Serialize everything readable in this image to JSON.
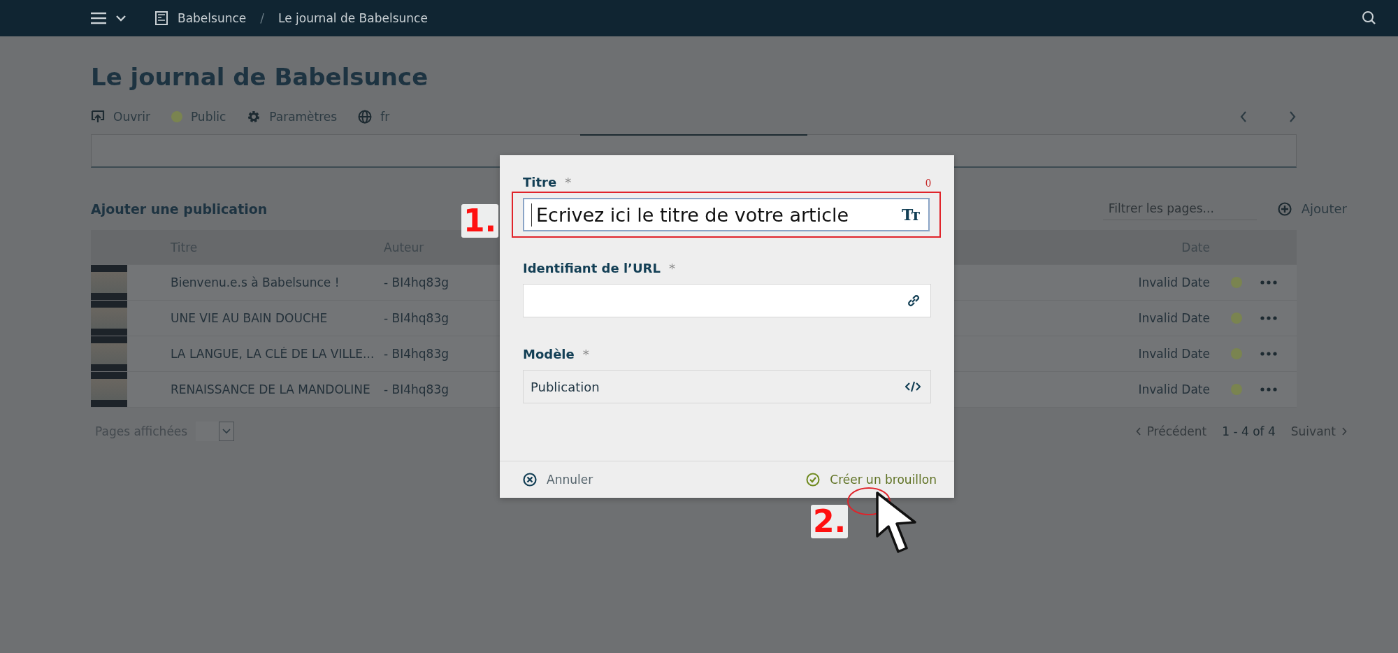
{
  "topbar": {
    "breadcrumb": [
      "Babelsunce",
      "Le journal de Babelsunce"
    ],
    "separator": "/"
  },
  "page": {
    "title": "Le journal de Babelsunce",
    "toolbar": [
      {
        "kind": "open",
        "label": "Ouvrir"
      },
      {
        "kind": "status",
        "label": "Public",
        "color": "#7a8450"
      },
      {
        "kind": "settings",
        "label": "Paramètres"
      },
      {
        "kind": "language",
        "label": "fr"
      }
    ]
  },
  "tabs": [
    {
      "selected": false
    },
    {
      "selected": true
    },
    {
      "selected": false
    }
  ],
  "section": {
    "title": "Ajouter une publication",
    "filter_placeholder": "Filtrer les pages...",
    "add_label": "Ajouter"
  },
  "table": {
    "columns": [
      "Titre",
      "Auteur",
      "Date"
    ],
    "rows": [
      {
        "title": "Bienvenu.e.s à Babelsunce !",
        "author": "- BI4hq83g",
        "date": "Invalid Date",
        "color": "#7a8450"
      },
      {
        "title": "UNE VIE AU BAIN DOUCHE",
        "author": "- BI4hq83g",
        "date": "Invalid Date",
        "color": "#7a8450"
      },
      {
        "title": "LA LANGUE, LA CLÉ DE LA VILLE...",
        "author": "- BI4hq83g",
        "date": "Invalid Date",
        "color": "#7a8450"
      },
      {
        "title": "RENAISSANCE DE LA MANDOLINE",
        "author": "- BI4hq83g",
        "date": "Invalid Date",
        "color": "#7a8450"
      }
    ]
  },
  "footer": {
    "pages_label": "Pages affichées",
    "previous": "Précédent",
    "range": "1 - 4 of 4",
    "next": "Suivant"
  },
  "dialog": {
    "fields": [
      {
        "kind": "title",
        "label": "Titre",
        "required": "*",
        "counter": "0",
        "placeholder": "Ecrivez ici le titre de votre article",
        "icon_text": "Tт"
      },
      {
        "kind": "url",
        "label": "Identifiant de l’URL",
        "required": "*"
      },
      {
        "kind": "template",
        "label": "Modèle",
        "required": "*",
        "value": "Publication"
      }
    ],
    "cancel": "Annuler",
    "confirm": "Créer un brouillon"
  },
  "annotations": [
    {
      "label": "1."
    },
    {
      "label": "2."
    }
  ]
}
